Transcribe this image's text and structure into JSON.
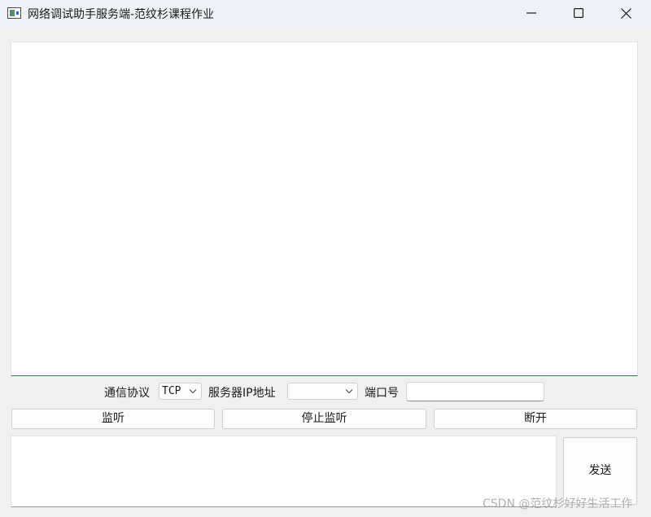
{
  "window": {
    "title": "网络调试助手服务端-范纹杉课程作业",
    "icon": "app-window-icon",
    "controls": [
      "minimize-icon",
      "maximize-icon",
      "close-icon"
    ]
  },
  "receive_area": {
    "value": ""
  },
  "settings": {
    "protocol_label": "通信协议",
    "protocol_value": "TCP",
    "server_ip_label": "服务器IP地址",
    "server_ip_value": "",
    "port_label": "端口号",
    "port_value": ""
  },
  "buttons": {
    "listen": "监听",
    "stop_listen": "停止监听",
    "disconnect": "断开",
    "send": "发送"
  },
  "send_area": {
    "value": ""
  },
  "watermark": "CSDN @范纹杉好好生活工作",
  "colors": {
    "background": "#f0f0f0",
    "titlebar": "#eef1f7",
    "focus_accent": "#2f6fad"
  }
}
